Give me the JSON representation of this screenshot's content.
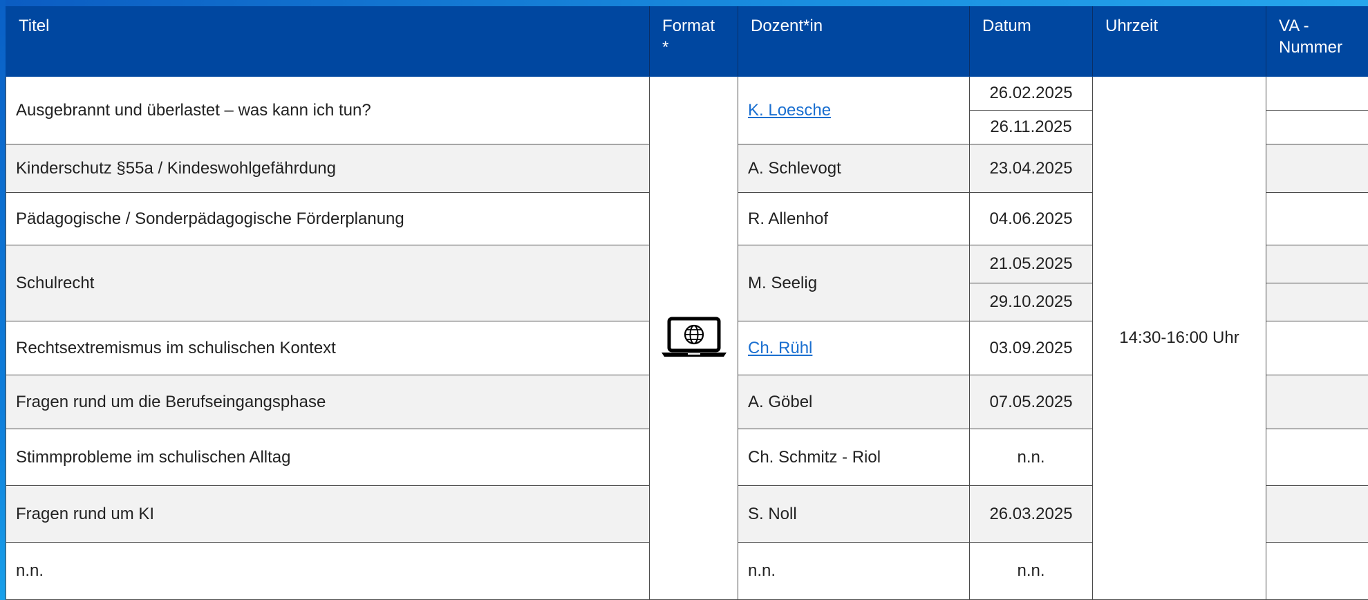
{
  "headers": {
    "title": "Titel",
    "format": "Format\n*",
    "lecturer": "Dozent*in",
    "date": "Datum",
    "time": "Uhrzeit",
    "va_number": "VA -\nNummer"
  },
  "time_value": "14:30-16:00 Uhr",
  "format_icon": "laptop-globe-icon",
  "colors": {
    "header_bg": "#0047a0",
    "row_grey": "#f2f2f2",
    "link": "#1a6fd0"
  },
  "rows": [
    {
      "title": "Ausgebrannt und überlastet – was kann ich tun?",
      "lecturer": "K. Loesche",
      "lecturer_link": true,
      "dates": [
        "26.02.2025",
        "26.11.2025"
      ]
    },
    {
      "title": "Kinderschutz §55a / Kindeswohlgefährdung",
      "lecturer": "A. Schlevogt",
      "lecturer_link": false,
      "dates": [
        "23.04.2025"
      ]
    },
    {
      "title": "Pädagogische / Sonderpädagogische Förderplanung",
      "lecturer": "R. Allenhof",
      "lecturer_link": false,
      "dates": [
        "04.06.2025"
      ]
    },
    {
      "title": "Schulrecht",
      "lecturer": "M. Seelig",
      "lecturer_link": false,
      "dates": [
        "21.05.2025",
        "29.10.2025"
      ]
    },
    {
      "title": "Rechtsextremismus im schulischen Kontext",
      "lecturer": "Ch. Rühl",
      "lecturer_link": true,
      "dates": [
        "03.09.2025"
      ]
    },
    {
      "title": "Fragen rund um die Berufseingangsphase",
      "lecturer": "A. Göbel",
      "lecturer_link": false,
      "dates": [
        "07.05.2025"
      ]
    },
    {
      "title": "Stimmprobleme im schulischen Alltag",
      "lecturer": "Ch. Schmitz - Riol",
      "lecturer_link": false,
      "dates": [
        "n.n."
      ]
    },
    {
      "title": "Fragen rund um KI",
      "lecturer": "S. Noll",
      "lecturer_link": false,
      "dates": [
        "26.03.2025"
      ]
    },
    {
      "title": "n.n.",
      "lecturer": "n.n.",
      "lecturer_link": false,
      "dates": [
        "n.n."
      ]
    }
  ]
}
